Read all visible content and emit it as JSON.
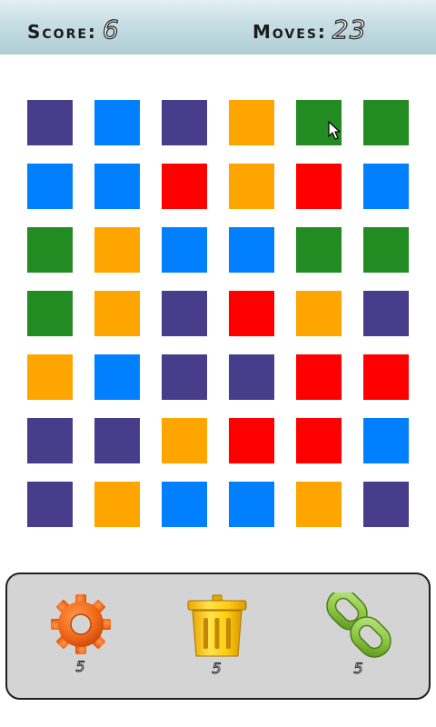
{
  "hud": {
    "score_label": "Score:",
    "score_value": "6",
    "moves_label": "Moves:",
    "moves_value": "23"
  },
  "board": {
    "rows": 7,
    "cols": 6,
    "palette": {
      "purple": "#483d8b",
      "blue": "#0080ff",
      "orange": "#ffa500",
      "green": "#228b22",
      "red": "#ff0000"
    },
    "tiles": [
      [
        "purple",
        "blue",
        "purple",
        "orange",
        "green",
        "green"
      ],
      [
        "blue",
        "blue",
        "red",
        "orange",
        "red",
        "blue"
      ],
      [
        "green",
        "orange",
        "blue",
        "blue",
        "green",
        "green"
      ],
      [
        "green",
        "orange",
        "purple",
        "red",
        "orange",
        "purple"
      ],
      [
        "orange",
        "blue",
        "purple",
        "purple",
        "red",
        "red"
      ],
      [
        "purple",
        "purple",
        "orange",
        "red",
        "red",
        "blue"
      ],
      [
        "purple",
        "orange",
        "blue",
        "blue",
        "orange",
        "purple"
      ]
    ]
  },
  "toolbar": {
    "items": [
      {
        "name": "settings",
        "icon": "gear-icon",
        "count": "5"
      },
      {
        "name": "delete",
        "icon": "trash-can-icon",
        "count": "5"
      },
      {
        "name": "link",
        "icon": "chain-link-icon",
        "count": "5"
      }
    ]
  }
}
